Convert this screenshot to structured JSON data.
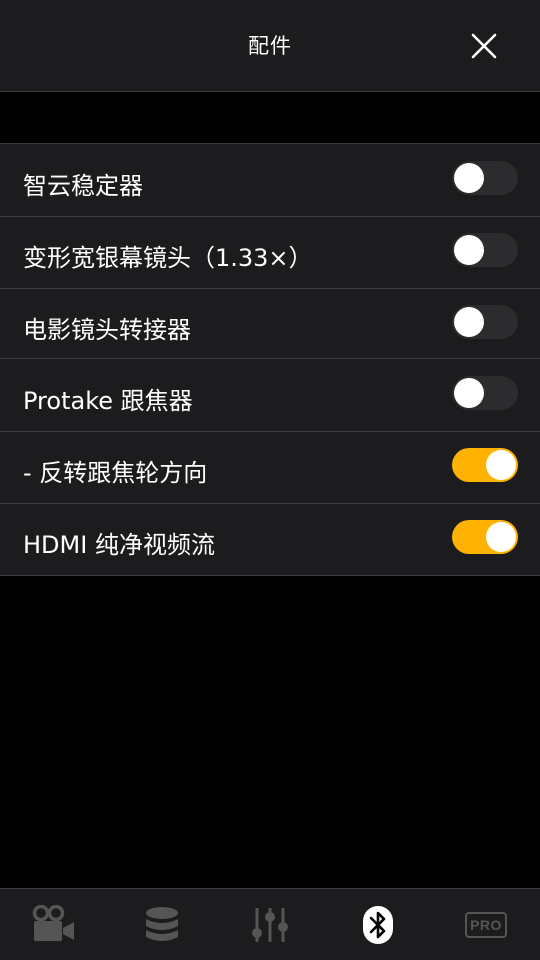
{
  "header": {
    "title": "配件",
    "close_icon": "close-icon"
  },
  "groups": [
    {
      "rows": [
        {
          "label": "智云稳定器",
          "on": false
        },
        {
          "label": "变形宽银幕镜头（1.33×）",
          "on": false
        },
        {
          "label": "电影镜头转接器",
          "on": false
        }
      ]
    },
    {
      "rows": [
        {
          "label": "Protake 跟焦器",
          "on": false
        },
        {
          "label": "- 反转跟焦轮方向",
          "on": true
        },
        {
          "label": "HDMI 纯净视频流",
          "on": true
        }
      ]
    }
  ],
  "tabbar": {
    "tabs": [
      {
        "icon": "video-camera-icon",
        "active": false
      },
      {
        "icon": "database-icon",
        "active": false
      },
      {
        "icon": "sliders-icon",
        "active": false
      },
      {
        "icon": "bluetooth-icon",
        "active": true
      },
      {
        "icon": "pro-badge-icon",
        "label": "PRO",
        "active": false
      }
    ]
  },
  "colors": {
    "accent": "#ffb300",
    "panel": "#1c1c1e",
    "divider": "#3a3a3c",
    "toggle_off": "#2c2c2e",
    "tab_inactive": "#555555"
  }
}
